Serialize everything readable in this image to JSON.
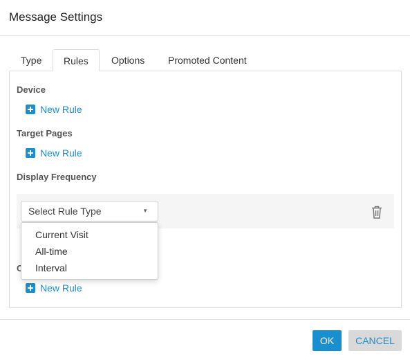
{
  "dialog": {
    "title": "Message Settings"
  },
  "tabs": [
    {
      "label": "Type"
    },
    {
      "label": "Rules",
      "active": true
    },
    {
      "label": "Options"
    },
    {
      "label": "Promoted Content"
    }
  ],
  "sections": {
    "device": {
      "label": "Device",
      "new_rule": "New Rule"
    },
    "target_pages": {
      "label": "Target Pages",
      "new_rule": "New Rule"
    },
    "display_frequency": {
      "label": "Display Frequency",
      "select_placeholder": "Select Rule Type",
      "options": [
        "Current Visit",
        "All-time",
        "Interval"
      ]
    },
    "hidden": {
      "label": "C",
      "new_rule": "New Rule"
    }
  },
  "footer": {
    "ok": "OK",
    "cancel": "CANCEL"
  },
  "colors": {
    "accent": "#1a8fd0",
    "cancel_bg": "#d9d9d9"
  }
}
